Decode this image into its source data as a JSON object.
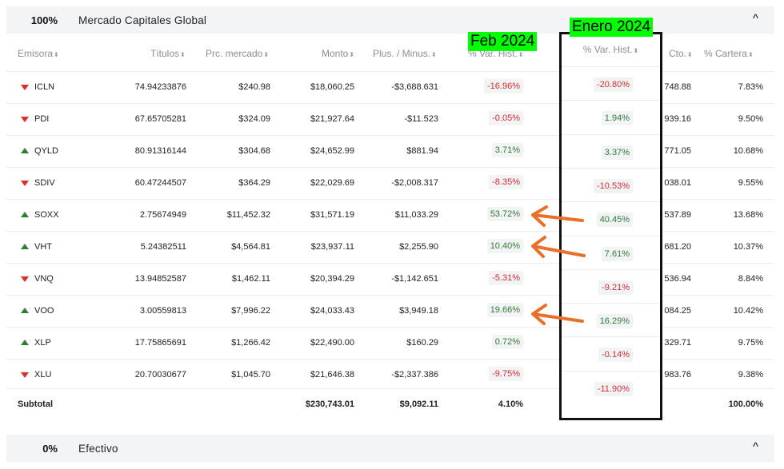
{
  "section1": {
    "pct": "100%",
    "name": "Mercado Capitales Global",
    "chevron": "^"
  },
  "section2": {
    "pct": "0%",
    "name": "Efectivo",
    "chevron": "^"
  },
  "headers": {
    "emisora": "Emisora",
    "titulos": "Títulos",
    "precio": "Prc. mercado",
    "monto": "Monto",
    "plus": "Plus. / Minus.",
    "var": "% Var. Hist.",
    "cto": "Cto.",
    "cartera": "% Cartera",
    "sort_icon": "⬍"
  },
  "rows": [
    {
      "ticker": "ICLN",
      "dir": "down",
      "titulos": "74.94233876",
      "precio": "$240.98",
      "monto": "$18,060.25",
      "plus": "-$3,688.631",
      "feb": "-16.96%",
      "feb_sign": "neg",
      "ene": "-20.80%",
      "ene_sign": "neg",
      "cto": "748.88",
      "cartera": "7.83%"
    },
    {
      "ticker": "PDI",
      "dir": "down",
      "titulos": "67.65705281",
      "precio": "$324.09",
      "monto": "$21,927.64",
      "plus": "-$11.523",
      "feb": "-0.05%",
      "feb_sign": "neg",
      "ene": "1.94%",
      "ene_sign": "pos",
      "cto": "939.16",
      "cartera": "9.50%"
    },
    {
      "ticker": "QYLD",
      "dir": "up",
      "titulos": "80.91316144",
      "precio": "$304.68",
      "monto": "$24,652.99",
      "plus": "$881.94",
      "feb": "3.71%",
      "feb_sign": "pos",
      "ene": "3.37%",
      "ene_sign": "pos",
      "cto": "771.05",
      "cartera": "10.68%"
    },
    {
      "ticker": "SDIV",
      "dir": "down",
      "titulos": "60.47244507",
      "precio": "$364.29",
      "monto": "$22,029.69",
      "plus": "-$2,008.317",
      "feb": "-8.35%",
      "feb_sign": "neg",
      "ene": "-10.53%",
      "ene_sign": "neg",
      "cto": "038.01",
      "cartera": "9.55%"
    },
    {
      "ticker": "SOXX",
      "dir": "up",
      "titulos": "2.75674949",
      "precio": "$11,452.32",
      "monto": "$31,571.19",
      "plus": "$11,033.29",
      "feb": "53.72%",
      "feb_sign": "pos",
      "ene": "40.45%",
      "ene_sign": "pos",
      "cto": "537.89",
      "cartera": "13.68%"
    },
    {
      "ticker": "VHT",
      "dir": "up",
      "titulos": "5.24382511",
      "precio": "$4,564.81",
      "monto": "$23,937.11",
      "plus": "$2,255.90",
      "feb": "10.40%",
      "feb_sign": "pos",
      "ene": "7.61%",
      "ene_sign": "pos",
      "cto": "681.20",
      "cartera": "10.37%"
    },
    {
      "ticker": "VNQ",
      "dir": "down",
      "titulos": "13.94852587",
      "precio": "$1,462.11",
      "monto": "$20,394.29",
      "plus": "-$1,142.651",
      "feb": "-5.31%",
      "feb_sign": "neg",
      "ene": "-9.21%",
      "ene_sign": "neg",
      "cto": "536.94",
      "cartera": "8.84%"
    },
    {
      "ticker": "VOO",
      "dir": "up",
      "titulos": "3.00559813",
      "precio": "$7,996.22",
      "monto": "$24,033.43",
      "plus": "$3,949.18",
      "feb": "19.66%",
      "feb_sign": "pos",
      "ene": "16.29%",
      "ene_sign": "pos",
      "cto": "084.25",
      "cartera": "10.42%"
    },
    {
      "ticker": "XLP",
      "dir": "up",
      "titulos": "17.75865691",
      "precio": "$1,266.42",
      "monto": "$22,490.00",
      "plus": "$160.29",
      "feb": "0.72%",
      "feb_sign": "pos",
      "ene": "-0.14%",
      "ene_sign": "neg",
      "cto": "329.71",
      "cartera": "9.75%"
    },
    {
      "ticker": "XLU",
      "dir": "down",
      "titulos": "20.70030677",
      "precio": "$1,045.70",
      "monto": "$21,646.38",
      "plus": "-$2,337.386",
      "feb": "-9.75%",
      "feb_sign": "neg",
      "ene": "-11.90%",
      "ene_sign": "neg",
      "cto": "983.76",
      "cartera": "9.38%"
    }
  ],
  "subtotal": {
    "label": "Subtotal",
    "monto": "$230,743.01",
    "plus": "$9,092.11",
    "feb": "4.10%",
    "cartera": "100.00%"
  },
  "labels": {
    "feb": "Feb 2024",
    "ene": "Enero 2024"
  },
  "colors": {
    "neg": "#d32f2f",
    "pos": "#2e7d32",
    "highlight": "#00ff00",
    "arrow": "#e8702a"
  }
}
